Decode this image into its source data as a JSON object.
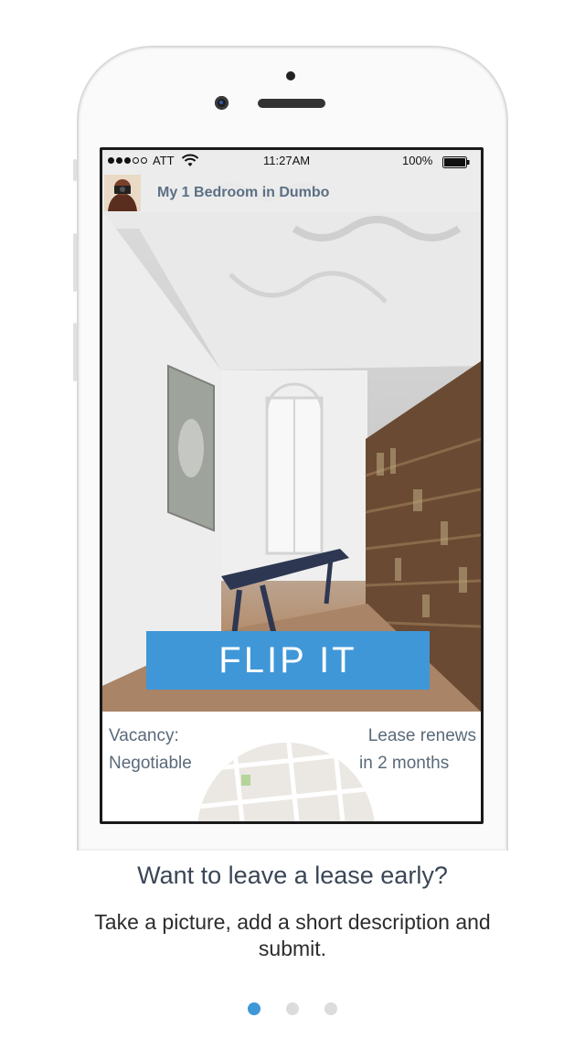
{
  "status_bar": {
    "carrier": "ATT",
    "time": "11:27AM",
    "battery": "100%",
    "signal_bars": 3
  },
  "listing": {
    "title": "My 1 Bedroom in Dumbo",
    "action_label": "FLIP IT",
    "vacancy_label": "Vacancy:",
    "vacancy_value": "Negotiable",
    "lease_line1": "Lease renews",
    "lease_line2": "in 2 months"
  },
  "onboarding": {
    "headline": "Want to leave a lease early?",
    "subtext": "Take a picture, add a short description and submit.",
    "page_count": 3,
    "active_page": 1
  },
  "colors": {
    "accent": "#3f97d8",
    "title_text": "#5c7085"
  }
}
